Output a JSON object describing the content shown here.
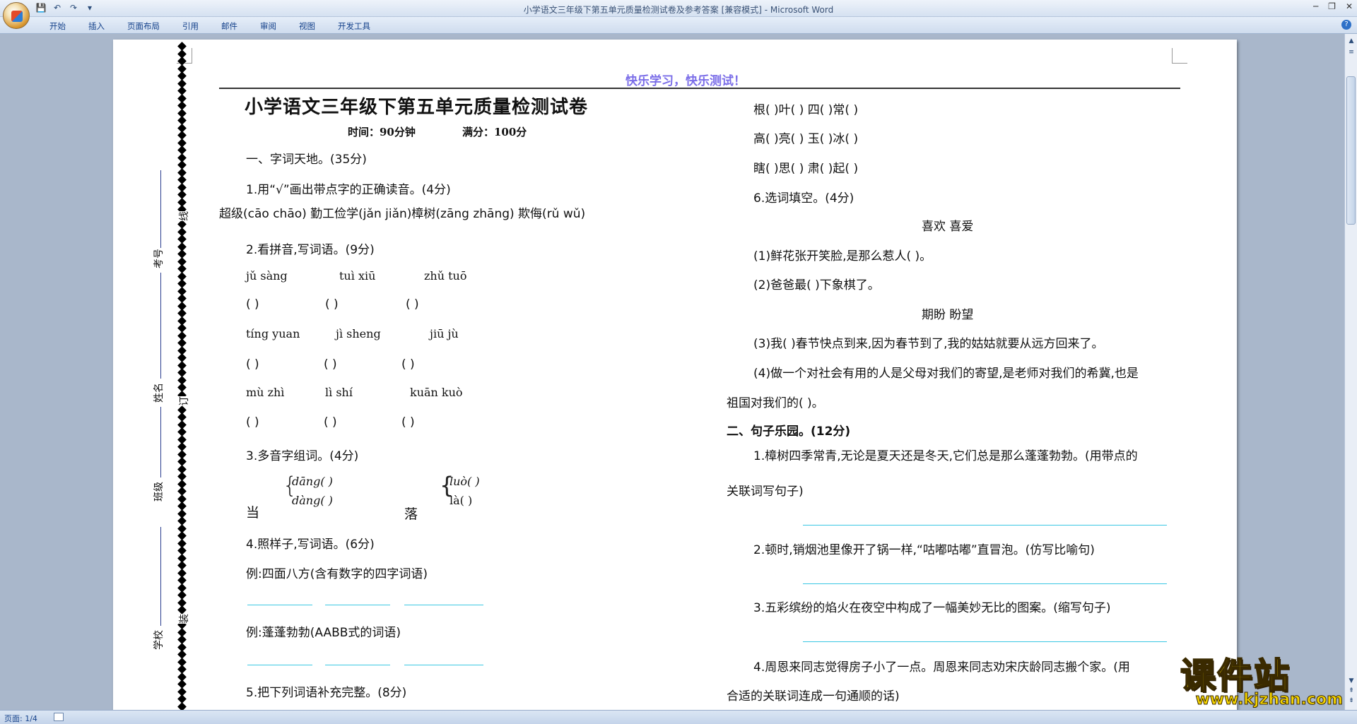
{
  "window": {
    "title": "小学语文三年级下第五单元质量检测试卷及参考答案 [兼容模式] - Microsoft Word",
    "controls": [
      "─",
      "❐",
      "✕"
    ]
  },
  "qat": {
    "save": "💾",
    "undo": "↶",
    "redo": "↷",
    "more": "▾"
  },
  "ribbon": {
    "tabs": [
      "开始",
      "插入",
      "页面布局",
      "引用",
      "邮件",
      "审阅",
      "视图",
      "开发工具"
    ],
    "help": "?"
  },
  "status": {
    "page": "页面: 1/4"
  },
  "colors": {
    "header": "#7b6ee8",
    "blank_line": "#39c7e3",
    "margin_line": "#2b3e8f"
  },
  "doc": {
    "header": "快乐学习，快乐测试！",
    "title": "小学语文三年级下第五单元质量检测试卷",
    "time": "时间：90分钟",
    "score": "满分：100分",
    "binding": {
      "kao_hao": "考号",
      "xing_ming": "姓名",
      "ban_ji": "班级",
      "xue_xiao": "学校",
      "xian": "线",
      "ding": "订",
      "zhuang": "装"
    },
    "left": {
      "sec1": "一、字词天地。(35分)",
      "q1": "1.用“√”画出带点字的正确读音。(4分)",
      "q1_items": "超级(cāo  chāo)   勤工俭学(jǎn  jiǎn)樟树(zāng  zhāng)   欺侮(rǔ  wǔ)",
      "q2": "2.看拼音,写词语。(9分)",
      "py1": [
        "jǔ sàng",
        "tuì  xiū",
        "zhǔ  tuō"
      ],
      "py2": [
        "tíng yuan",
        "jì  sheng",
        "jiū  jù"
      ],
      "py3": [
        "mù  zhì",
        "lì   shí",
        "kuān kuò"
      ],
      "paren": "(              )",
      "q3": "3.多音字组词。(4分)",
      "dang": "当",
      "dang1": "dāng(            )",
      "dang2": "dàng(            )",
      "luo": "落",
      "luo1": "luò(          )",
      "luo2": "là(            )",
      "q4": "4.照样子,写词语。(6分)",
      "ex1": "例:四面八方(含有数字的四字词语)",
      "ex2": "例:蓬蓬勃勃(AABB式的词语)",
      "q5": "5.把下列词语补充完整。(8分)"
    },
    "right": {
      "r1": "根(      )叶(      )   四(      )常(      )",
      "r2": "高(      )亮(      )   玉(      )冰(      )",
      "r3": "瞎(      )思(      )   肃(      )起(      )",
      "q6": "6.选词填空。(4分)",
      "w1": "喜欢       喜爱",
      "s1": "(1)鲜花张开笑脸,是那么惹人(          )。",
      "s2": "(2)爸爸最(          )下象棋了。",
      "w2": "期盼       盼望",
      "s3": "(3)我(          )春节快点到来,因为春节到了,我的姑姑就要从远方回来了。",
      "s4a": "(4)做一个对社会有用的人是父母对我们的寄望,是老师对我们的希冀,也是",
      "s4b": "祖国对我们的(          )。",
      "sec2": "二、句子乐园。(12分)",
      "p1a": "1.樟树四季常青,无论是夏天还是冬天,它们总是那么蓬蓬勃勃。(用带点的",
      "p1b": "关联词写句子)",
      "p2": "2.顿时,销烟池里像开了锅一样,“咕嘟咕嘟”直冒泡。(仿写比喻句)",
      "p3": "3.五彩缤纷的焰火在夜空中构成了一幅美妙无比的图案。(缩写句子)",
      "p4a": "4.周恩来同志觉得房子小了一点。周恩来同志劝宋庆龄同志搬个家。(用",
      "p4b": "合适的关联词连成一句通顺的话)"
    }
  },
  "watermark": {
    "text": "课件站",
    "url": "www.kjzhan.com"
  }
}
